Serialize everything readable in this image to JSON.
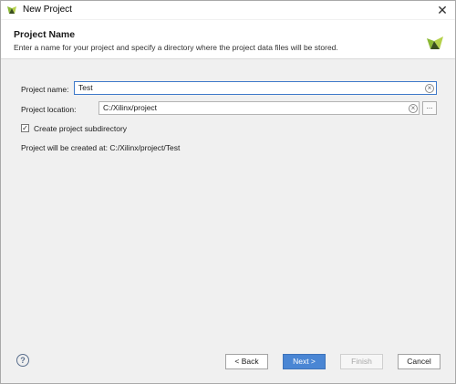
{
  "window": {
    "title": "New Project",
    "close_glyph": "✕"
  },
  "header": {
    "title": "Project Name",
    "description": "Enter a name for your project and specify a directory where the project data files will be stored."
  },
  "form": {
    "project_name_label": "Project name:",
    "project_name_value": "Test",
    "project_location_label": "Project location:",
    "project_location_value": "C:/Xilinx/project",
    "browse_label": "...",
    "create_subdir_label": "Create project subdirectory",
    "create_subdir_checked": true,
    "created_at_text": "Project will be created at: C:/Xilinx/project/Test"
  },
  "footer": {
    "help_label": "?",
    "back_label": "< Back",
    "next_label": "Next >",
    "finish_label": "Finish",
    "cancel_label": "Cancel"
  },
  "icons": {
    "title_logo": "vivado-logo-icon",
    "header_logo": "vivado-logo-icon",
    "clear": "clear-icon",
    "check": "✓"
  },
  "colors": {
    "accent": "#4a86d4",
    "logo_green": "#8ab833",
    "logo_dark": "#3a4e1f"
  }
}
